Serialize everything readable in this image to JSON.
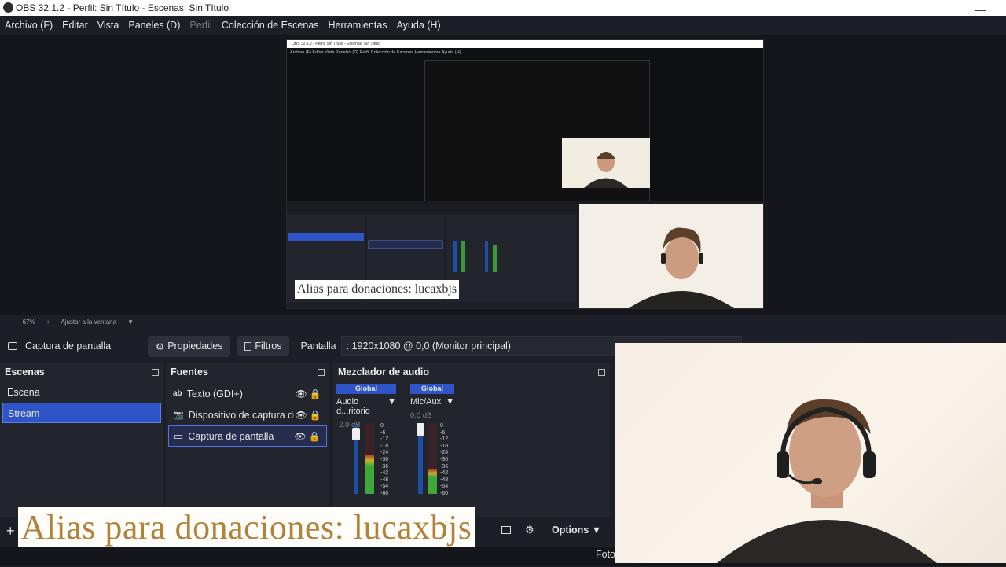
{
  "window": {
    "title": "OBS 32.1.2 - Perfil: Sin Título - Escenas: Sin Título",
    "minimize_glyph": "—"
  },
  "menu": [
    "Archivo (F)",
    "Editar",
    "Vista",
    "Paneles (D)",
    "Perfil",
    "Colección de Escenas",
    "Herramientas",
    "Ayuda (H)"
  ],
  "preview": {
    "nested_title": "OBS 32.1.2 - Perfil: Sin Título - Escenas: Sin Título",
    "nested_menu": "Archivo (F)   Editar   Vista   Paneles (D)   Perfil   Colección de Escenas   Herramientas   Ayuda (H)",
    "nested_alias": "Alias para donaciones: lucaxbjs",
    "nested_options": "Options",
    "nested_foto": "Foto"
  },
  "zoom": {
    "minus": "−",
    "level": "67%",
    "plus": "+",
    "fit": "Ajustar a la ventana",
    "dropdown": "▼"
  },
  "context": {
    "source_name": "Captura de pantalla",
    "properties": "Propiedades",
    "filters": "Filtros",
    "screen_label": "Pantalla",
    "screen_value": ": 1920x1080 @ 0,0 (Monitor principal)"
  },
  "scenes": {
    "title": "Escenas",
    "items": [
      {
        "label": "Escena",
        "selected": false
      },
      {
        "label": "Stream",
        "selected": true
      }
    ]
  },
  "sources": {
    "title": "Fuentes",
    "items": [
      {
        "label": "Texto (GDI+)",
        "icon": "text-icon",
        "glyph": "ab",
        "selected": false
      },
      {
        "label": "Dispositivo de captura de video",
        "icon": "camera-icon",
        "glyph": "📷",
        "selected": false
      },
      {
        "label": "Captura de pantalla",
        "icon": "monitor-icon",
        "glyph": "▭",
        "selected": true
      }
    ]
  },
  "mixer": {
    "title": "Mezclador de audio",
    "channels": [
      {
        "head": "Global",
        "name": "Audio d...ritorio",
        "db": "-2.0 dB",
        "level": 0.55
      },
      {
        "head": "Global",
        "name": "Mic/Aux",
        "db": "0.0 dB",
        "level": 0.35
      }
    ],
    "ticks": [
      "0",
      "-6",
      "-12",
      "-18",
      "-24",
      "-30",
      "-36",
      "-42",
      "-48",
      "-54",
      "-60"
    ]
  },
  "bottom": {
    "add": "+",
    "options": "Options"
  },
  "overlay": {
    "alias": "Alias para donaciones: lucaxbjs"
  },
  "status": {
    "foto": "Foto"
  },
  "colors": {
    "accent": "#2e54c8",
    "panel": "#23252d",
    "bg": "#1d1f26"
  }
}
